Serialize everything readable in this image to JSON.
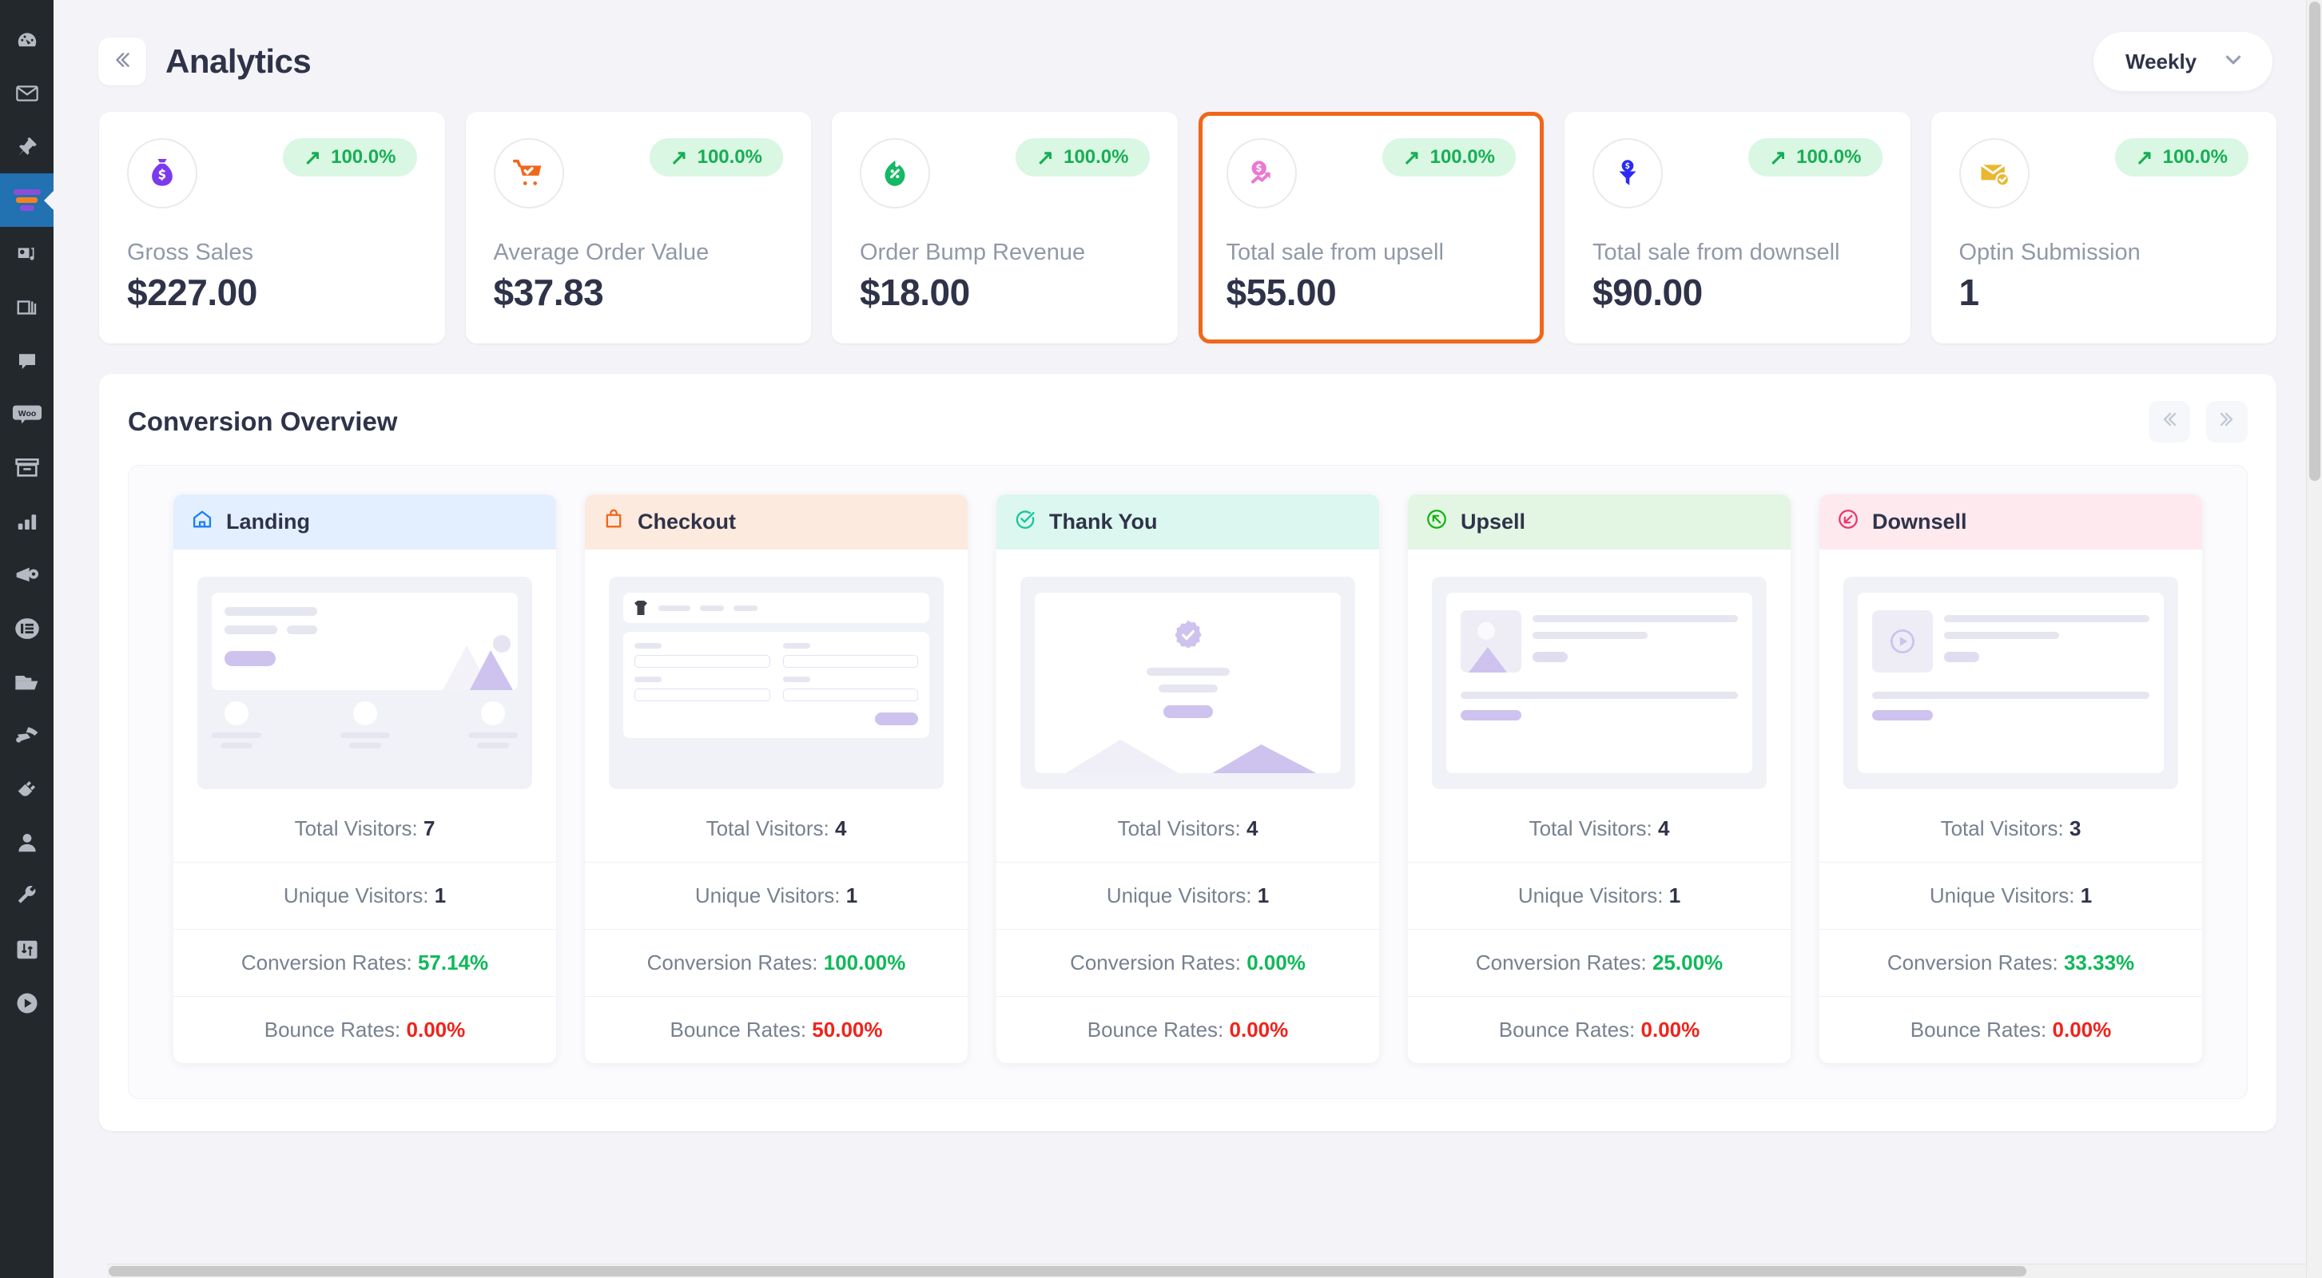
{
  "sidebar": {
    "items": [
      {
        "name": "dashboard",
        "icon": "speedometer-icon"
      },
      {
        "name": "mail",
        "icon": "envelope-icon"
      },
      {
        "name": "pin",
        "icon": "pin-icon"
      },
      {
        "name": "funnel",
        "icon": "funnel-icon",
        "active": true
      },
      {
        "name": "media",
        "icon": "media-icon"
      },
      {
        "name": "pages",
        "icon": "pages-icon"
      },
      {
        "name": "comments",
        "icon": "comment-icon"
      },
      {
        "name": "woocommerce",
        "icon": "woo-icon"
      },
      {
        "name": "archive",
        "icon": "archive-icon"
      },
      {
        "name": "analytics",
        "icon": "bar-chart-icon"
      },
      {
        "name": "marketing",
        "icon": "megaphone-icon"
      },
      {
        "name": "forms",
        "icon": "list-icon"
      },
      {
        "name": "files",
        "icon": "folder-icon"
      },
      {
        "name": "appearance",
        "icon": "paintbrush-icon"
      },
      {
        "name": "plugins",
        "icon": "plug-icon"
      },
      {
        "name": "users",
        "icon": "user-icon"
      },
      {
        "name": "tools",
        "icon": "wrench-icon"
      },
      {
        "name": "settings",
        "icon": "sliders-icon"
      },
      {
        "name": "player",
        "icon": "play-circle-icon"
      }
    ]
  },
  "header": {
    "collapse_icon": "chevron-double-left-icon",
    "title": "Analytics",
    "period": {
      "label": "Weekly",
      "chevron_icon": "chevron-down-icon"
    }
  },
  "stats": [
    {
      "icon": "money-bag-icon",
      "icon_color": "#7C3AED",
      "badge": {
        "arrow": "↗",
        "value": "100.0%"
      },
      "label": "Gross Sales",
      "value": "$227.00",
      "highlight": false
    },
    {
      "icon": "shopping-cart-check-icon",
      "icon_color": "#F1671A",
      "badge": {
        "arrow": "↗",
        "value": "100.0%"
      },
      "label": "Average Order Value",
      "value": "$37.83",
      "highlight": false
    },
    {
      "icon": "discount-flame-icon",
      "icon_color": "#16B864",
      "badge": {
        "arrow": "↗",
        "value": "100.0%"
      },
      "label": "Order Bump Revenue",
      "value": "$18.00",
      "highlight": false
    },
    {
      "icon": "upsell-trend-dollar-icon",
      "icon_color": "#E879D4",
      "badge": {
        "arrow": "↗",
        "value": "100.0%"
      },
      "label": "Total sale from upsell",
      "value": "$55.00",
      "highlight": true
    },
    {
      "icon": "funnel-dollar-icon",
      "icon_color": "#2B2BF5",
      "badge": {
        "arrow": "↗",
        "value": "100.0%"
      },
      "label": "Total sale from downsell",
      "value": "$90.00",
      "highlight": false
    },
    {
      "icon": "envelope-check-icon",
      "icon_color": "#EBB battery",
      "badge": {
        "arrow": "↗",
        "value": "100.0%"
      },
      "label": "Optin Submission",
      "value": "1",
      "highlight": false
    }
  ],
  "conversion": {
    "title": "Conversion Overview",
    "prev_icon": "chevron-double-left-icon",
    "next_icon": "chevron-double-right-icon",
    "labels": {
      "total_visitors": "Total Visitors:",
      "unique_visitors": "Unique Visitors:",
      "conversion_rates": "Conversion Rates:",
      "bounce_rates": "Bounce Rates:"
    },
    "steps": [
      {
        "name": "Landing",
        "icon": "home-icon",
        "header_bg": "#e3efff",
        "icon_color": "#1b7ff5",
        "total_visitors": "7",
        "unique_visitors": "1",
        "conversion_rate": "57.14%",
        "bounce_rate": "0.00%",
        "mock": "landing"
      },
      {
        "name": "Checkout",
        "icon": "shopping-bag-icon",
        "header_bg": "#fdeade",
        "icon_color": "#f1671a",
        "total_visitors": "4",
        "unique_visitors": "1",
        "conversion_rate": "100.00%",
        "bounce_rate": "50.00%",
        "mock": "checkout"
      },
      {
        "name": "Thank You",
        "icon": "check-circle-icon",
        "header_bg": "#dcf7ef",
        "icon_color": "#16c79a",
        "total_visitors": "4",
        "unique_visitors": "1",
        "conversion_rate": "0.00%",
        "bounce_rate": "0.00%",
        "mock": "thankyou"
      },
      {
        "name": "Upsell",
        "icon": "arrow-up-left-circle-icon",
        "header_bg": "#e3f6e3",
        "icon_color": "#12b312",
        "total_visitors": "4",
        "unique_visitors": "1",
        "conversion_rate": "25.00%",
        "bounce_rate": "0.00%",
        "mock": "upsell"
      },
      {
        "name": "Downsell",
        "icon": "arrow-down-left-circle-icon",
        "header_bg": "#fde9ee",
        "icon_color": "#e8366b",
        "total_visitors": "3",
        "unique_visitors": "1",
        "conversion_rate": "33.33%",
        "bounce_rate": "0.00%",
        "mock": "downsell"
      }
    ]
  },
  "colors": {
    "accent_orange": "#f1671a",
    "positive_green": "#0fb959",
    "negative_red": "#f0231b",
    "text_dark": "#2f3349",
    "text_muted": "#9199a8"
  }
}
